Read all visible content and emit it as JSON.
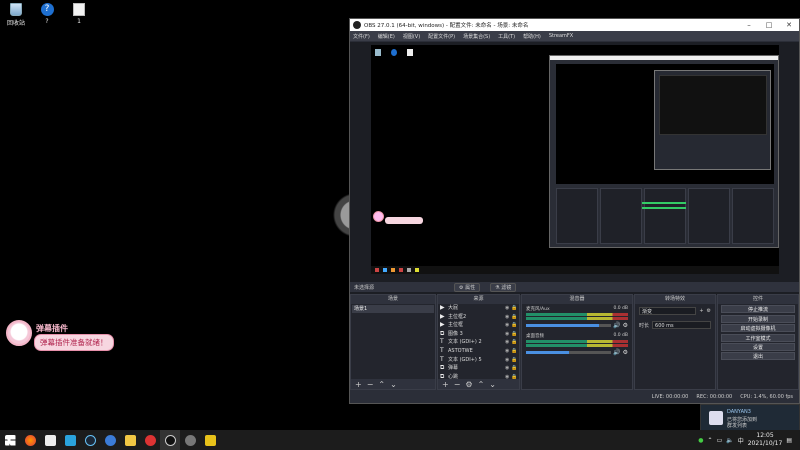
{
  "desktop": {
    "icons": [
      {
        "label": "回收站"
      },
      {
        "label": "?"
      },
      {
        "label": "1"
      }
    ],
    "plugin_widget": {
      "title": "弹幕插件",
      "message": "弹幕插件准备就绪！"
    }
  },
  "obs": {
    "title": "OBS 27.0.1 (64-bit, windows) - 配置文件: 未命名 - 场景: 未命名",
    "menu": [
      "文件(F)",
      "编辑(E)",
      "视图(V)",
      "配置文件(P)",
      "场景集合(S)",
      "工具(T)",
      "帮助(H)",
      "StreamFX"
    ],
    "no_source_selected": "未选择源",
    "properties_label": "属性",
    "filters_label": "滤镜",
    "scenes": {
      "title": "场景",
      "items": [
        "场景1"
      ]
    },
    "sources": {
      "title": "来源",
      "items": [
        {
          "type": "▶",
          "name": "大屁"
        },
        {
          "type": "▶",
          "name": "主位框2"
        },
        {
          "type": "▶",
          "name": "主位框"
        },
        {
          "type": "⧉",
          "name": "图像 3"
        },
        {
          "type": "T",
          "name": "文本 (GDI+) 2"
        },
        {
          "type": "T",
          "name": "ASTOTWE"
        },
        {
          "type": "T",
          "name": "文本 (GDI+) 5"
        },
        {
          "type": "⧉",
          "name": "弹幕"
        },
        {
          "type": "⧉",
          "name": "心跳"
        },
        {
          "type": "⧉",
          "name": "心跳2"
        }
      ]
    },
    "mixer": {
      "title": "混音器",
      "channels": [
        {
          "name": "麦克风/Aux",
          "db": "0.0 dB",
          "level": 0.86
        },
        {
          "name": "桌面音频",
          "db": "0.0 dB",
          "level": 0.5
        }
      ]
    },
    "transitions": {
      "title": "转场特效",
      "type": "渐变",
      "duration_label": "时长",
      "duration": "600 ms"
    },
    "controls": {
      "title": "控件",
      "buttons": [
        "停止推流",
        "开始录制",
        "启动虚拟摄像机",
        "工作室模式",
        "设置",
        "退出"
      ]
    },
    "status": {
      "live_label": "LIVE:",
      "live_time": "00:00:00",
      "rec_label": "REC:",
      "rec_time": "00:00:00",
      "cpu": "CPU: 1.4%, 60.00 fps"
    }
  },
  "notification": {
    "name": "DANYAN3",
    "line2": "已将您添加到",
    "line3": "群发列表"
  },
  "taskbar": {
    "time": "12:05",
    "date": "2021/10/17"
  }
}
